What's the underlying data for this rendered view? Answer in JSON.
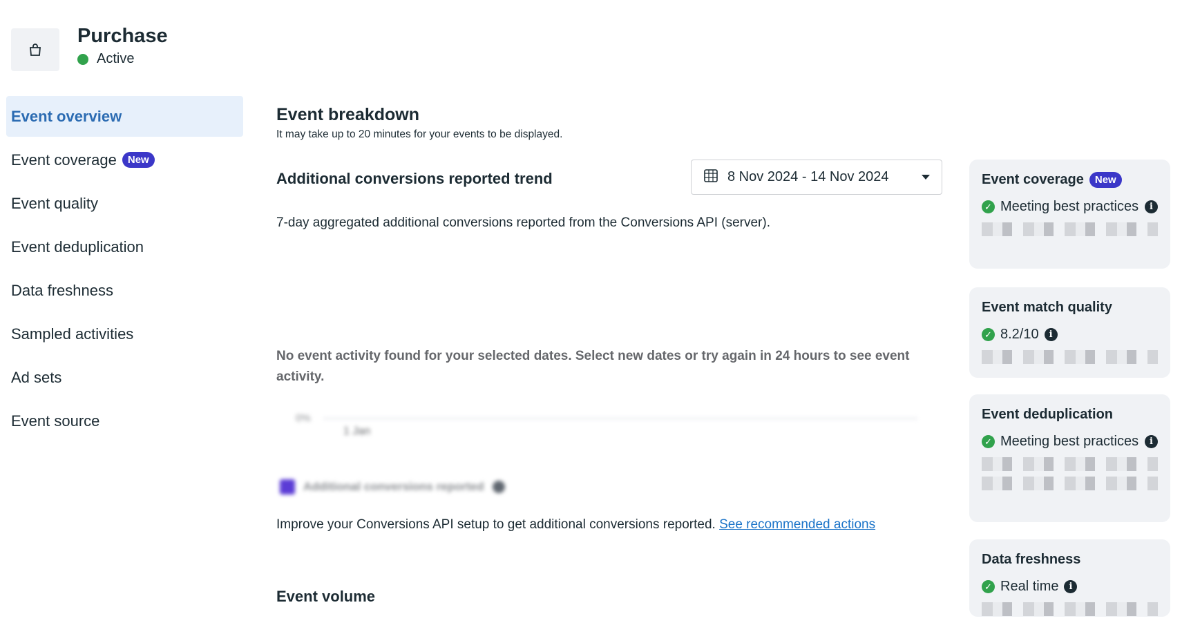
{
  "header": {
    "title": "Purchase",
    "status": "Active",
    "status_color": "#31a24c",
    "icon": "shopping-bag-icon"
  },
  "sidebar": {
    "items": [
      {
        "label": "Event overview",
        "active": true
      },
      {
        "label": "Event coverage",
        "badge": "New"
      },
      {
        "label": "Event quality"
      },
      {
        "label": "Event deduplication"
      },
      {
        "label": "Data freshness"
      },
      {
        "label": "Sampled activities"
      },
      {
        "label": "Ad sets"
      },
      {
        "label": "Event source"
      }
    ]
  },
  "main": {
    "title": "Event breakdown",
    "subtitle": "It may take up to 20 minutes for your events to be displayed.",
    "trend_title": "Additional conversions reported trend",
    "date_range": "8 Nov 2024 - 14 Nov 2024",
    "trend_desc": "7-day aggregated additional conversions reported from the Conversions API (server).",
    "empty_state": "No event activity found for your selected dates. Select new dates or try again in 24 hours to see event activity.",
    "blurred_chart": {
      "y_tick": "0%",
      "x_tick": "1 Jan",
      "legend": "Additional conversions reported"
    },
    "improve_text": "Improve your Conversions API setup to get additional conversions reported.",
    "improve_link": "See recommended actions",
    "volume_title": "Event volume"
  },
  "cards": [
    {
      "title": "Event coverage",
      "badge": "New",
      "status": "Meeting best practices"
    },
    {
      "title": "Event match quality",
      "status": "8.2/10"
    },
    {
      "title": "Event deduplication",
      "status": "Meeting best practices"
    },
    {
      "title": "Data freshness",
      "status": "Real time"
    }
  ],
  "colors": {
    "accent": "#2b6bb2",
    "badge": "#3b37c8",
    "link": "#1a73c8",
    "success": "#31a24c"
  }
}
